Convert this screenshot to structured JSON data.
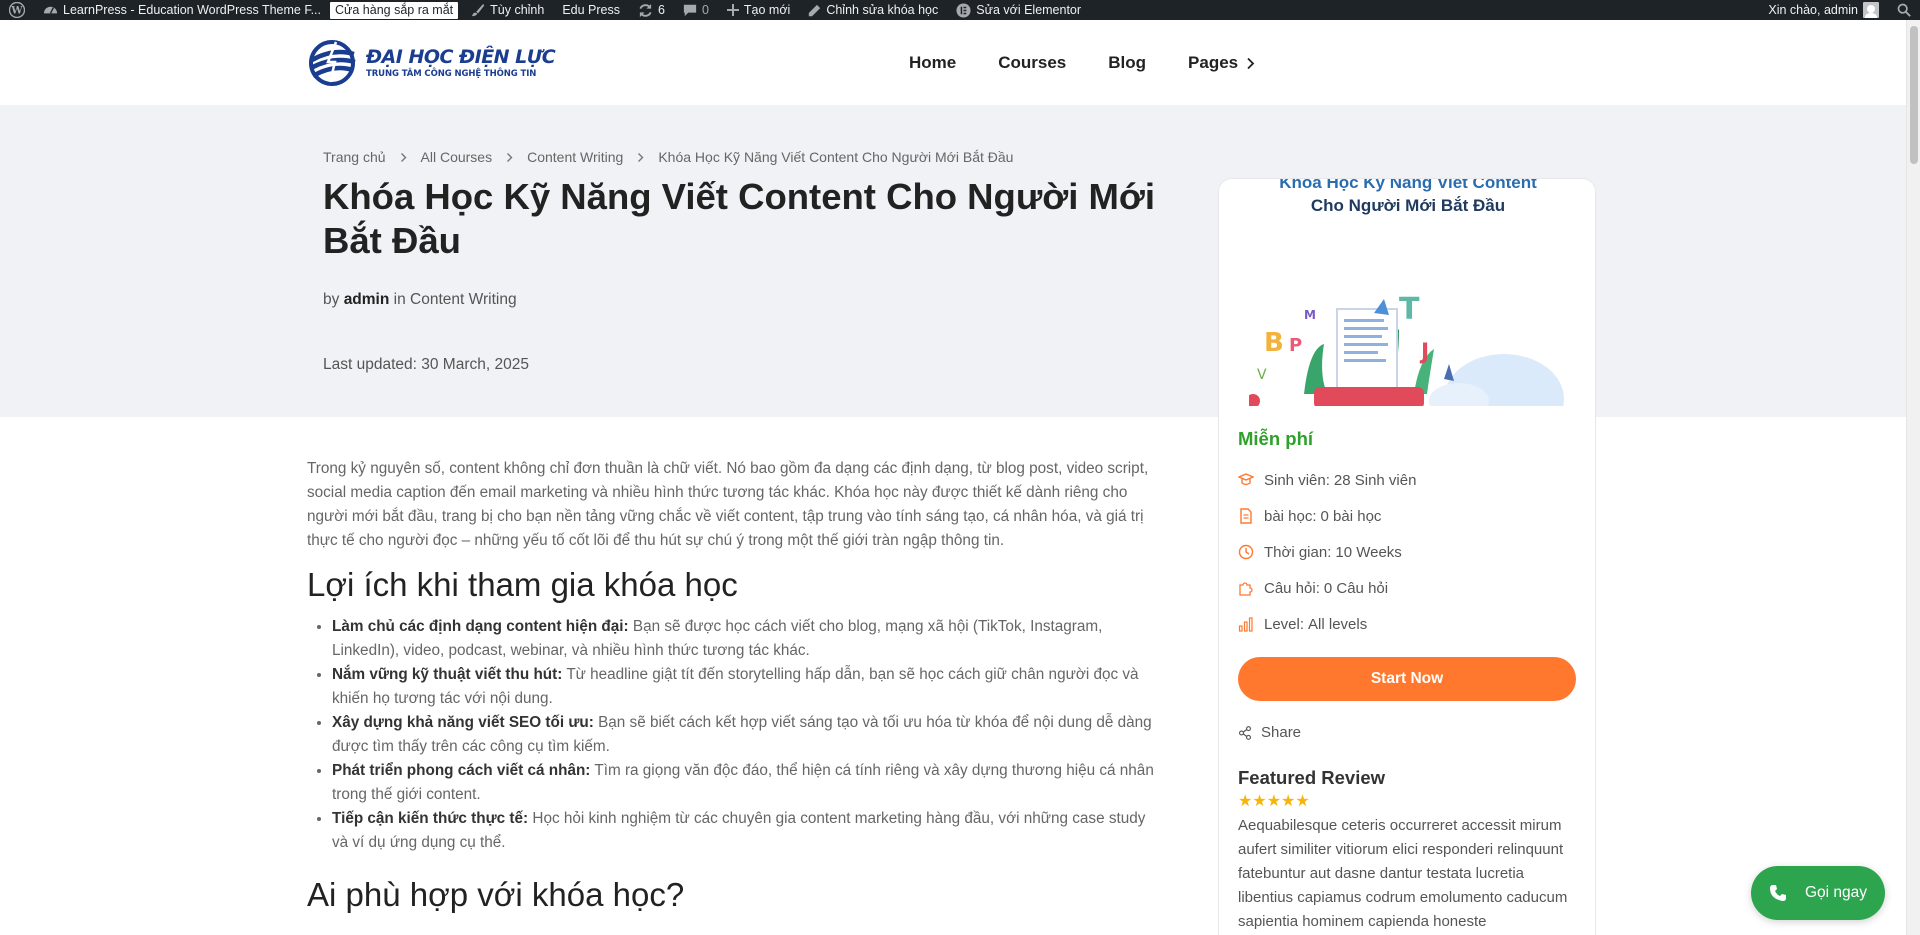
{
  "admin_bar": {
    "site_name": "LearnPress - Education WordPress Theme F...",
    "store_label": "Cửa hàng sắp ra mắt",
    "customize": "Tùy chỉnh",
    "edu_press": "Edu Press",
    "updates_count": "6",
    "comments_count": "0",
    "new_label": "Tạo mới",
    "edit_course": "Chỉnh sửa khóa học",
    "elementor": "Sửa với Elementor",
    "greeting": "Xin chào, admin"
  },
  "header": {
    "logo_title": "ĐẠI HỌC ĐIỆN LỰC",
    "logo_subtitle": "TRUNG TÂM CÔNG NGHỆ THÔNG TIN",
    "nav": [
      "Home",
      "Courses",
      "Blog",
      "Pages"
    ]
  },
  "hero": {
    "breadcrumb": [
      "Trang chủ",
      "All Courses",
      "Content Writing",
      "Khóa Học Kỹ Năng Viết Content Cho Người Mới Bắt Đầu"
    ],
    "title": "Khóa Học Kỹ Năng Viết Content Cho Người Mới Bắt Đầu",
    "by": "by",
    "author": "admin",
    "in": "in",
    "category": "Content Writing",
    "last_updated": "Last updated: 30 March, 2025"
  },
  "content": {
    "intro": "Trong kỷ nguyên số, content không chỉ đơn thuần là chữ viết. Nó bao gồm đa dạng các định dạng, từ blog post, video script, social media caption đến email marketing và nhiều hình thức tương tác khác. Khóa học này được thiết kế dành riêng cho người mới bắt đầu, trang bị cho bạn nền tảng vững chắc về viết content, tập trung vào tính sáng tạo, cá nhân hóa, và giá trị thực tế cho người đọc – những yếu tố cốt lõi để thu hút sự chú ý trong một thế giới tràn ngập thông tin.",
    "benefits_heading": "Lợi ích khi tham gia khóa học",
    "benefits": [
      {
        "bold": "Làm chủ các định dạng content hiện đại:",
        "text": " Bạn sẽ được học cách viết cho blog, mạng xã hội (TikTok, Instagram, LinkedIn), video, podcast, webinar, và nhiều hình thức tương tác khác."
      },
      {
        "bold": "Nắm vững kỹ thuật viết thu hút:",
        "text": " Từ headline giật tít đến storytelling hấp dẫn, bạn sẽ học cách giữ chân người đọc và khiến họ tương tác với nội dung."
      },
      {
        "bold": "Xây dựng khả năng viết SEO tối ưu:",
        "text": " Bạn sẽ biết cách kết hợp viết sáng tạo và tối ưu hóa từ khóa để nội dung dễ dàng được tìm thấy trên các công cụ tìm kiếm."
      },
      {
        "bold": "Phát triển phong cách viết cá nhân:",
        "text": " Tìm ra giọng văn độc đáo, thể hiện cá tính riêng và xây dựng thương hiệu cá nhân trong thế giới content."
      },
      {
        "bold": "Tiếp cận kiến thức thực tế:",
        "text": " Học hỏi kinh nghiệm từ các chuyên gia content marketing hàng đầu, với những case study và ví dụ ứng dụng cụ thể."
      }
    ],
    "audience_heading": "Ai phù hợp với khóa học?"
  },
  "sidebar": {
    "thumb_title_line1": "Khóa Học Kỹ Năng Viết Content",
    "thumb_title_line2": "Cho Người Mới Bắt Đầu",
    "price": "Miễn phí",
    "meta": [
      {
        "icon": "student-icon",
        "label": "Sinh viên:",
        "value": "28 Sinh viên"
      },
      {
        "icon": "lesson-file-icon",
        "label": "bài học:",
        "value": "0 bài học"
      },
      {
        "icon": "clock-icon",
        "label": "Thời gian:",
        "value": "10 Weeks"
      },
      {
        "icon": "puzzle-icon",
        "label": "Câu hỏi:",
        "value": "0 Câu hỏi"
      },
      {
        "icon": "level-bars-icon",
        "label": "Level:",
        "value": "All levels"
      }
    ],
    "start_button": "Start Now",
    "share": "Share",
    "review_heading": "Featured Review",
    "rating": 5,
    "stars": "★★★★★",
    "review_text": "Aequabilesque ceteris occurreret accessit mirum aufert similiter vitiorum elici responderi relinquunt fatebuntur aut dasne dantur testata lucretia libentius capiamus codrum emolumento caducum sapientia hominem capienda honeste"
  },
  "call_button": "Gọi ngay",
  "colors": {
    "accent": "#ff782d",
    "price_green": "#2da12a",
    "call_green": "#2da44e",
    "admin_bar": "#1d2327",
    "hero_bg": "#f1f2f5"
  }
}
